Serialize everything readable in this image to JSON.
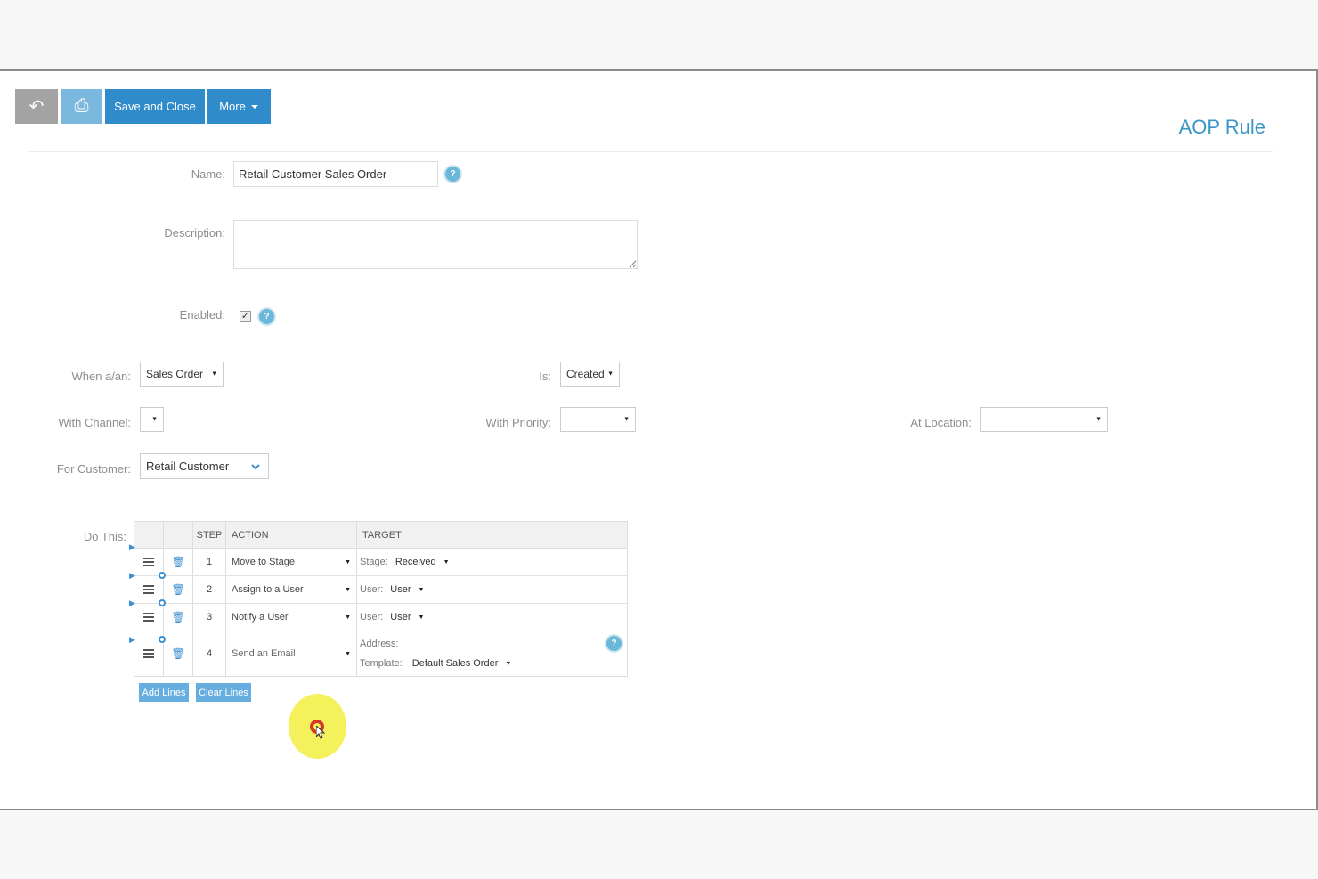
{
  "toolbar": {
    "back_icon": "↶",
    "print_icon": "⎙",
    "save_label": "Save and Close",
    "more_label": "More"
  },
  "page_title": "AOP Rule",
  "form": {
    "name_label": "Name:",
    "name_value": "Retail Customer Sales Order",
    "description_label": "Description:",
    "description_value": "",
    "enabled_label": "Enabled:",
    "enabled_mark": "✓",
    "when_label": "When a/an:",
    "when_value": "Sales Order",
    "is_label": "Is:",
    "is_value": "Created",
    "channel_label": "With Channel:",
    "channel_value": "",
    "priority_label": "With Priority:",
    "priority_value": "",
    "location_label": "At Location:",
    "location_value": "",
    "customer_label": "For Customer:",
    "customer_value": "Retail Customer",
    "do_this_label": "Do This:"
  },
  "help_icon": "?",
  "dropdown_arrow": "▼",
  "steps": {
    "headers": {
      "step": "STEP",
      "action": "ACTION",
      "target": "TARGET"
    },
    "rows": [
      {
        "step": "1",
        "action": "Move to Stage",
        "target_label": "Stage:",
        "target_value": "Received"
      },
      {
        "step": "2",
        "action": "Assign to a User",
        "target_label": "User:",
        "target_value": "User"
      },
      {
        "step": "3",
        "action": "Notify a User",
        "target_label": "User:",
        "target_value": "User"
      },
      {
        "step": "4",
        "action": "Send an Email",
        "address_label": "Address:",
        "template_label": "Template:",
        "template_value": "Default Sales Order"
      }
    ],
    "trash_icon": "🗑",
    "marker_icon": "▶"
  },
  "buttons": {
    "add_lines": "Add Lines",
    "clear_lines": "Clear Lines"
  }
}
